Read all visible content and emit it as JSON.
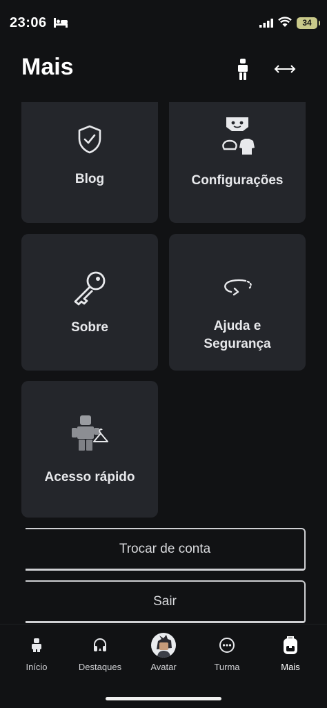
{
  "status_bar": {
    "time": "23:06",
    "battery": "34"
  },
  "header": {
    "title": "Mais"
  },
  "tiles": {
    "blog": "Blog",
    "config": "Configurações",
    "sobre": "Sobre",
    "ajuda_line1": "Ajuda e",
    "ajuda_line2": "Segurança",
    "acesso": "Acesso rápido"
  },
  "buttons": {
    "trocar": "Trocar de conta",
    "sair": "Sair"
  },
  "tabbar": {
    "items": [
      {
        "label": "Início"
      },
      {
        "label": "Destaques"
      },
      {
        "label": "Avatar"
      },
      {
        "label": "Turma"
      },
      {
        "label": "Mais",
        "active": true
      }
    ]
  }
}
